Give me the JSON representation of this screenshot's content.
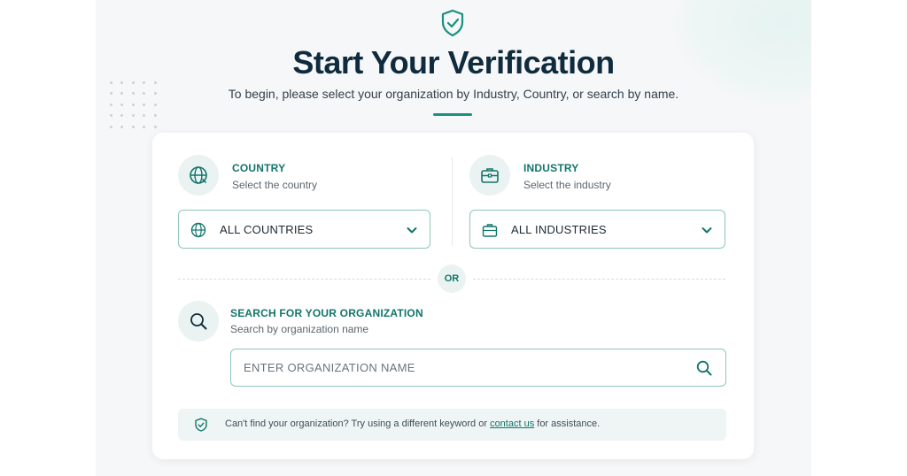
{
  "header": {
    "title": "Start Your Verification",
    "subtitle": "To begin, please select your organization by Industry, Country, or search by name."
  },
  "country": {
    "title": "COUNTRY",
    "subtitle": "Select the country",
    "select_value": "ALL COUNTRIES"
  },
  "industry": {
    "title": "INDUSTRY",
    "subtitle": "Select the industry",
    "select_value": "ALL INDUSTRIES"
  },
  "divider": {
    "label": "OR"
  },
  "search": {
    "title": "SEARCH FOR YOUR ORGANIZATION",
    "subtitle": "Search by organization name",
    "placeholder": "ENTER ORGANIZATION NAME",
    "value": ""
  },
  "notice": {
    "text_before": "Can't find your organization? Try using a different keyword or ",
    "link_label": "contact us",
    "text_after": " for assistance."
  },
  "icons": {
    "header": "shield-check-icon",
    "country": "globe-icon",
    "industry": "briefcase-icon",
    "search": "search-icon",
    "chevron": "chevron-down-icon",
    "notice": "shield-check-icon"
  },
  "colors": {
    "accent": "#11756b",
    "accent_bar": "#1b8f80",
    "title": "#0f2b3d",
    "input_border": "#8ec5bd",
    "icon_bg": "#eaf3f2",
    "page_bg": "#f6f7f8"
  }
}
